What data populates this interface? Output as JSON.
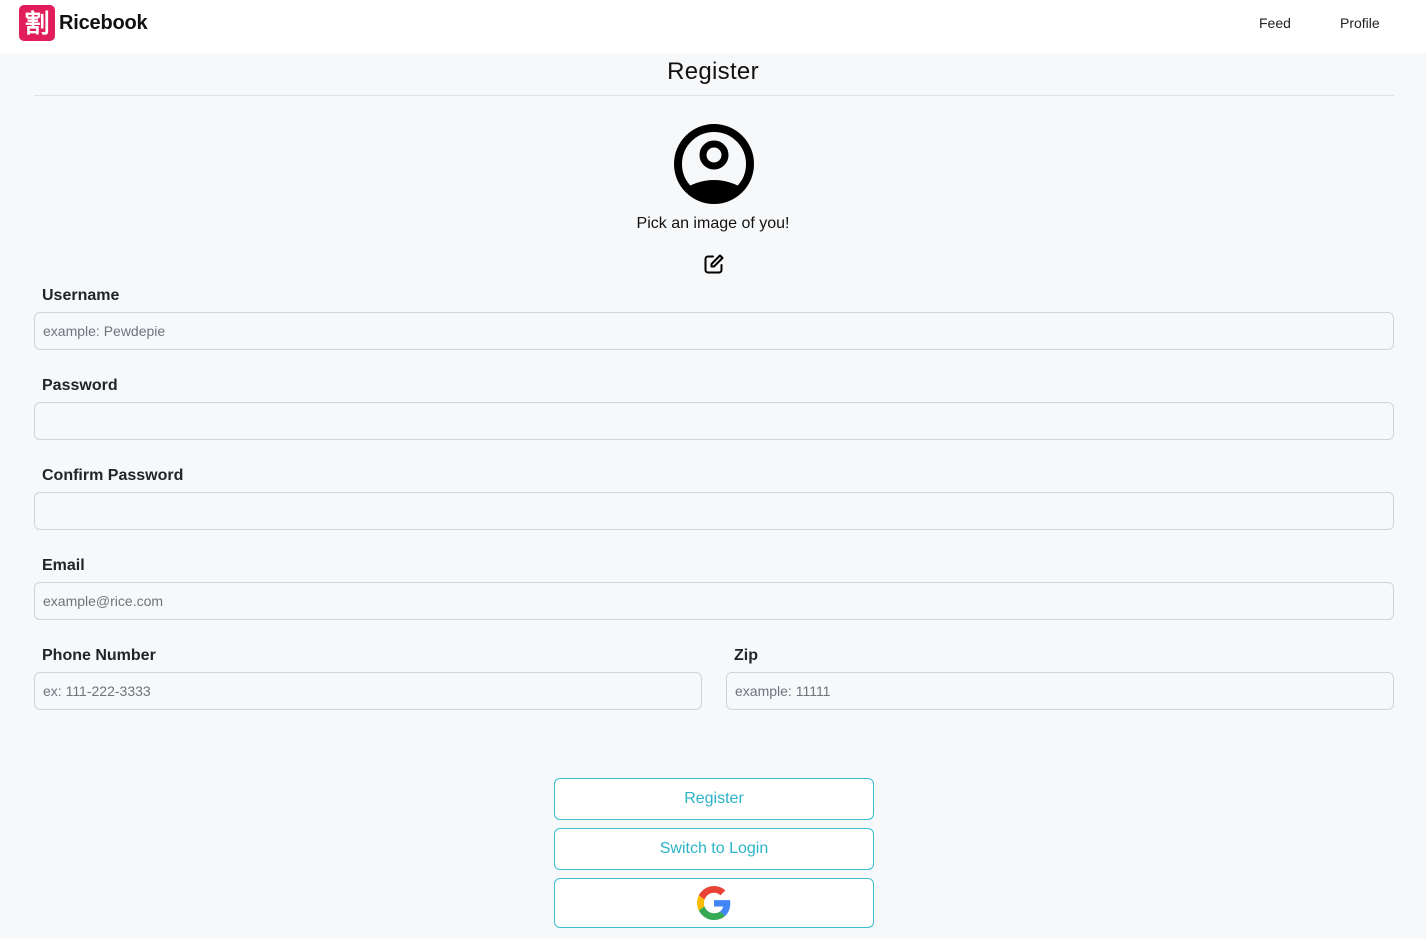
{
  "nav": {
    "brand": "Ricebook",
    "brand_logo_char": "割",
    "links": [
      "Feed",
      "Profile"
    ],
    "brand_color": "#e21d5c"
  },
  "page": {
    "title": "Register",
    "avatar_prompt": "Pick an image of you!"
  },
  "form": {
    "username": {
      "label": "Username",
      "placeholder": "example: Pewdepie",
      "value": ""
    },
    "password": {
      "label": "Password",
      "placeholder": "",
      "value": ""
    },
    "confirm_password": {
      "label": "Confirm Password",
      "placeholder": "",
      "value": ""
    },
    "email": {
      "label": "Email",
      "placeholder": "example@rice.com",
      "value": ""
    },
    "phone": {
      "label": "Phone Number",
      "placeholder": "ex: 111-222-3333",
      "value": ""
    },
    "zip": {
      "label": "Zip",
      "placeholder": "example: 11111",
      "value": ""
    }
  },
  "buttons": {
    "register": "Register",
    "switch_login": "Switch to Login",
    "google_icon": "google-icon"
  },
  "colors": {
    "accent": "#2bb3c6",
    "background": "#f7f8fa"
  }
}
